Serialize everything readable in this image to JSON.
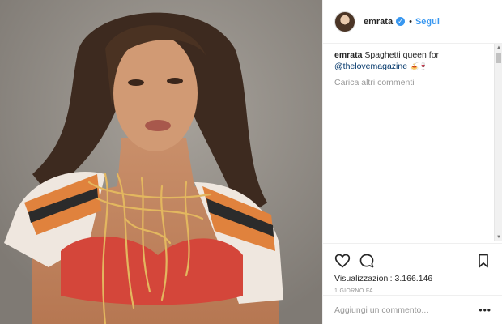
{
  "post": {
    "author": "emrata",
    "verified_icon": "verified-badge-icon",
    "separator": "•",
    "follow_label": "Segui",
    "caption": {
      "user": "emrata",
      "text": "Spaghetti queen for",
      "mention": "@thelovemagazine",
      "emojis": "🍝🍷"
    },
    "load_more_label": "Carica altri commenti",
    "actions": {
      "like_icon": "heart-icon",
      "comment_icon": "comment-icon",
      "save_icon": "bookmark-icon"
    },
    "views_label": "Visualizzazioni:",
    "views_count": "3.166.146",
    "timestamp": "1 GIORNO FA",
    "comment_placeholder": "Aggiungi un commento...",
    "more_options": "•••"
  },
  "colors": {
    "accent": "#3897f0",
    "mention": "#003569",
    "muted": "#999999",
    "text": "#262626",
    "border": "#efefef"
  }
}
